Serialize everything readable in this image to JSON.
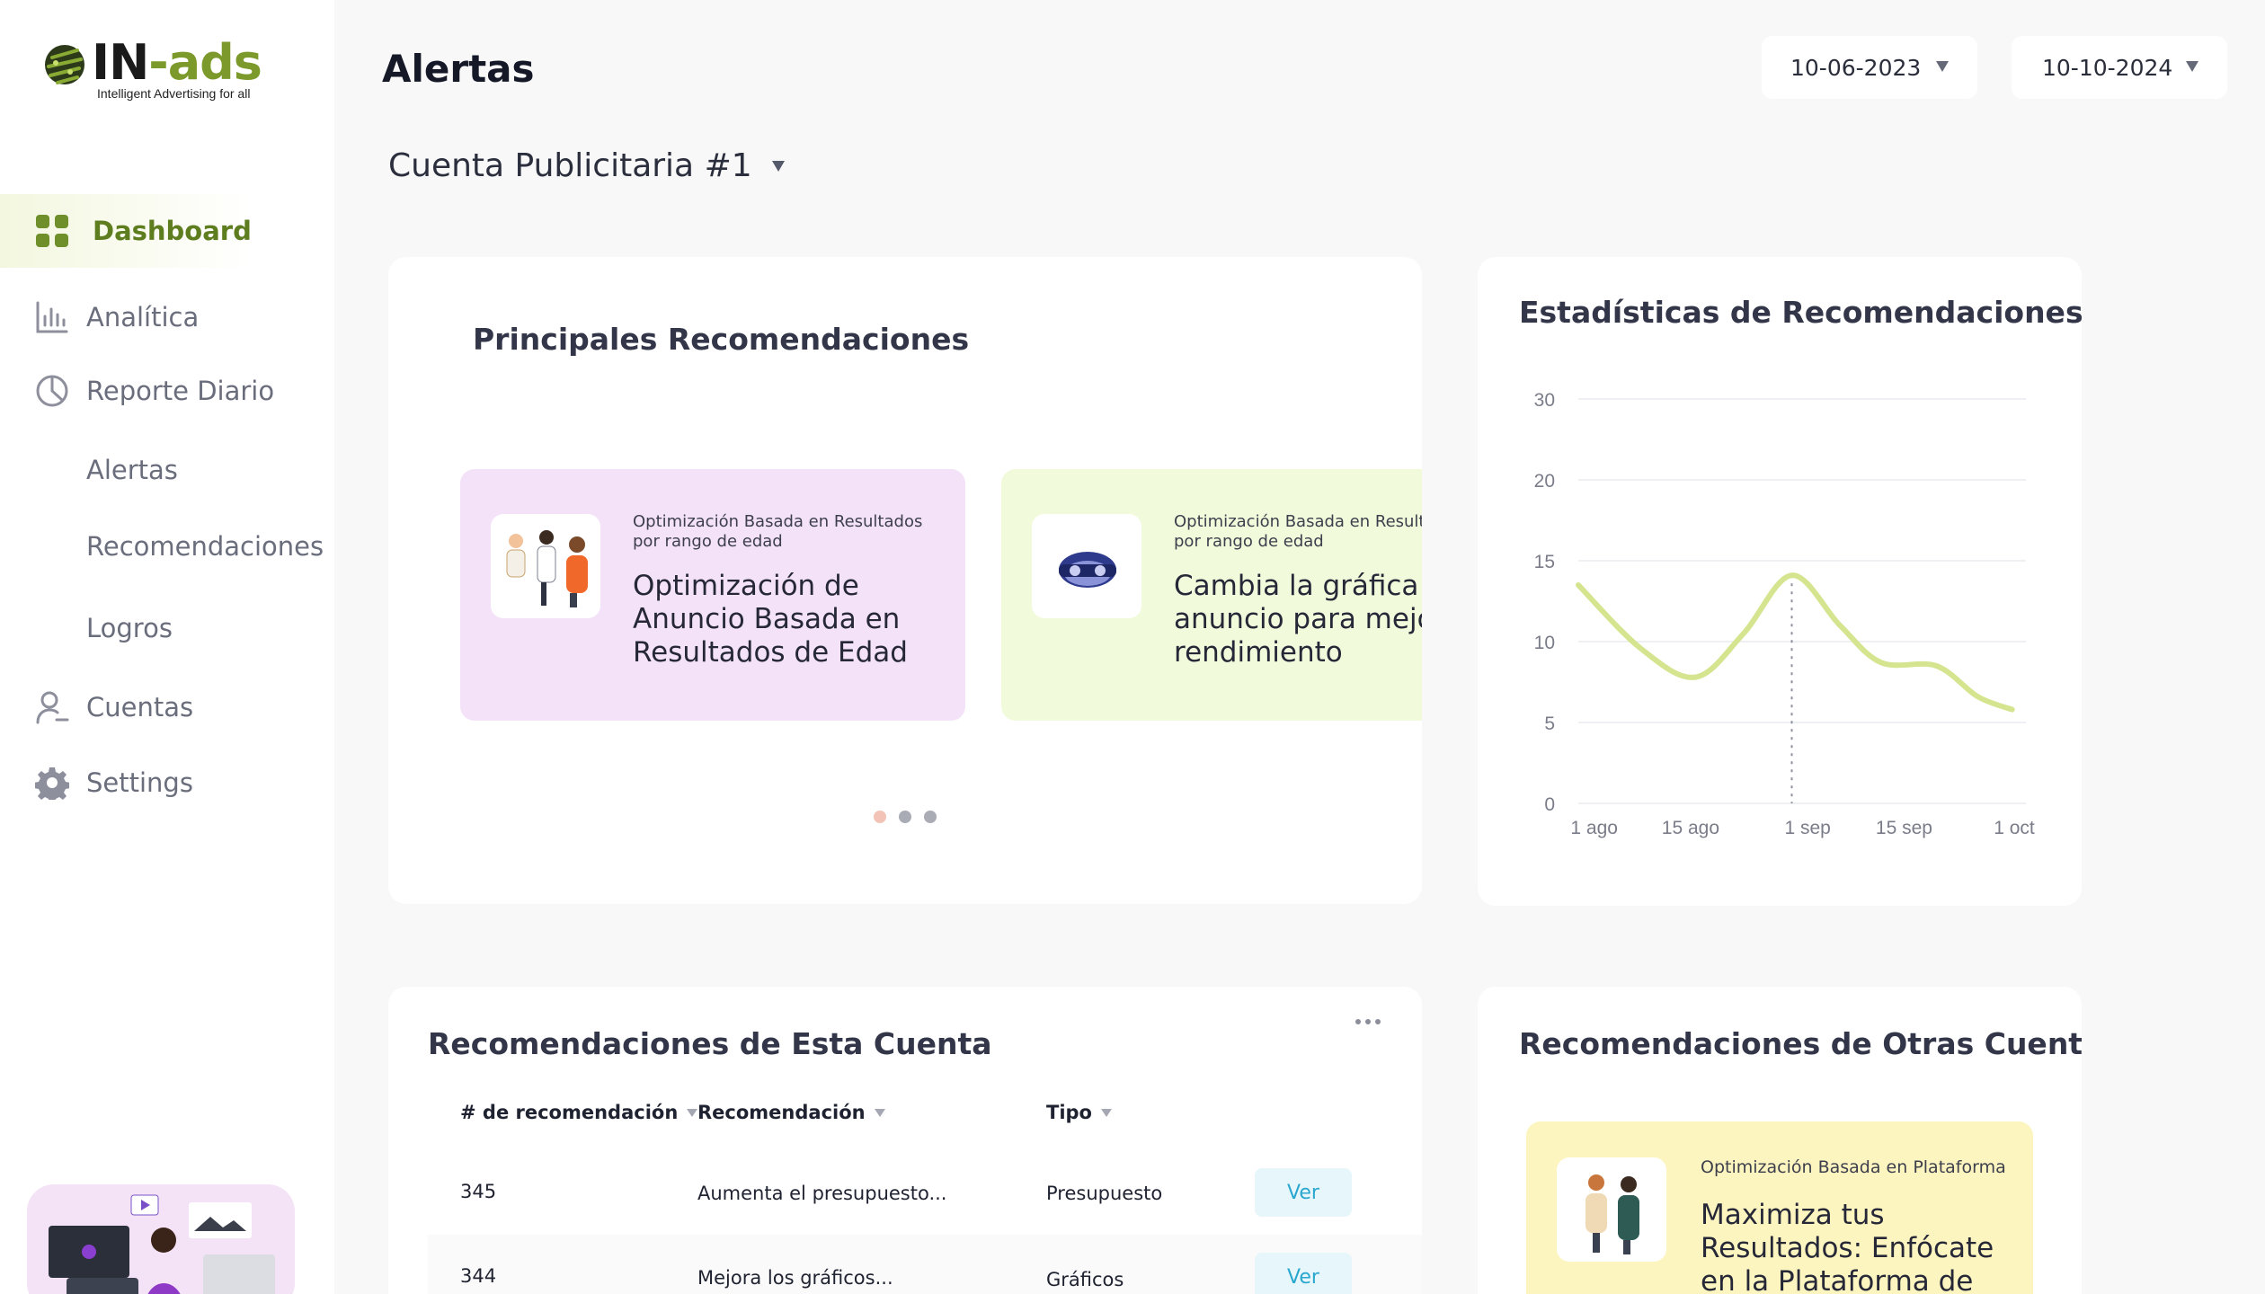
{
  "brand": {
    "logo_main": "IN",
    "logo_dash": "-ads",
    "tagline": "Intelligent Advertising for all",
    "accent": "#7c9a2c"
  },
  "sidebar": {
    "items": [
      {
        "label": "Dashboard",
        "icon": "grid-icon",
        "active": true
      },
      {
        "label": "Analítica",
        "icon": "bar-chart-icon"
      },
      {
        "label": "Reporte Diario",
        "icon": "pie-chart-icon"
      },
      {
        "label": "Alertas"
      },
      {
        "label": "Recomendaciones"
      },
      {
        "label": "Logros"
      },
      {
        "label": "Cuentas",
        "icon": "user-icon"
      },
      {
        "label": "Settings",
        "icon": "gear-icon"
      }
    ]
  },
  "header": {
    "title": "Alertas",
    "date_from": "10-06-2023",
    "date_to": "10-10-2024"
  },
  "account": {
    "selected": "Cuenta Publicitaria #1"
  },
  "top_recs": {
    "title": "Principales Recomendaciones",
    "cards": [
      {
        "category": "Optimización Basada en Resultados por rango de edad",
        "title": "Optimización de Anuncio Basada en Resultados de Edad",
        "bg": "#f4e2f8"
      },
      {
        "category": "Optimización Basada en Resultados por rango de edad",
        "title": "Cambia la gráfica c anuncio para mejo el rendimiento",
        "bg": "#f1fbdc"
      }
    ],
    "carousel_pages": 3,
    "carousel_active": 1
  },
  "stats": {
    "title": "Estadísticas de Recomendaciones"
  },
  "chart_data": {
    "type": "line",
    "title": "Estadísticas de Recomendaciones",
    "xlabel": "",
    "ylabel": "",
    "x_ticks": [
      "1 ago",
      "15 ago",
      "1 sep",
      "15 sep",
      "1 oct"
    ],
    "y_ticks": [
      0,
      5,
      10,
      15,
      20,
      30
    ],
    "grid": true,
    "line_color": "#d4e48f",
    "series": [
      {
        "points": [
          {
            "x": "2024-07-31",
            "y": 13.5
          },
          {
            "x": "2024-08-09",
            "y": 9.6
          },
          {
            "x": "2024-08-17",
            "y": 7.8
          },
          {
            "x": "2024-08-24",
            "y": 10.5
          },
          {
            "x": "2024-08-31",
            "y": 14.1
          },
          {
            "x": "2024-09-07",
            "y": 11.0
          },
          {
            "x": "2024-09-13",
            "y": 8.7
          },
          {
            "x": "2024-09-21",
            "y": 8.5
          },
          {
            "x": "2024-09-27",
            "y": 6.6
          },
          {
            "x": "2024-10-02",
            "y": 5.8
          }
        ]
      }
    ],
    "highlight_x": "2024-08-31"
  },
  "this_account": {
    "title": "Recomendaciones de Esta Cuenta",
    "columns": [
      "# de recomendación",
      "Recomendación",
      "Tipo"
    ],
    "rows": [
      {
        "id": "345",
        "rec": "Aumenta el presupuesto...",
        "type": "Presupuesto",
        "action": "Ver"
      },
      {
        "id": "344",
        "rec": "Mejora los gráficos...",
        "type": "Gráficos",
        "action": "Ver"
      }
    ]
  },
  "other_accounts": {
    "title": "Recomendaciones de Otras Cuentas",
    "card": {
      "category": "Optimización Basada en Plataforma",
      "title": "Maximiza tus Resultados: Enfócate en la Plataforma de"
    }
  }
}
